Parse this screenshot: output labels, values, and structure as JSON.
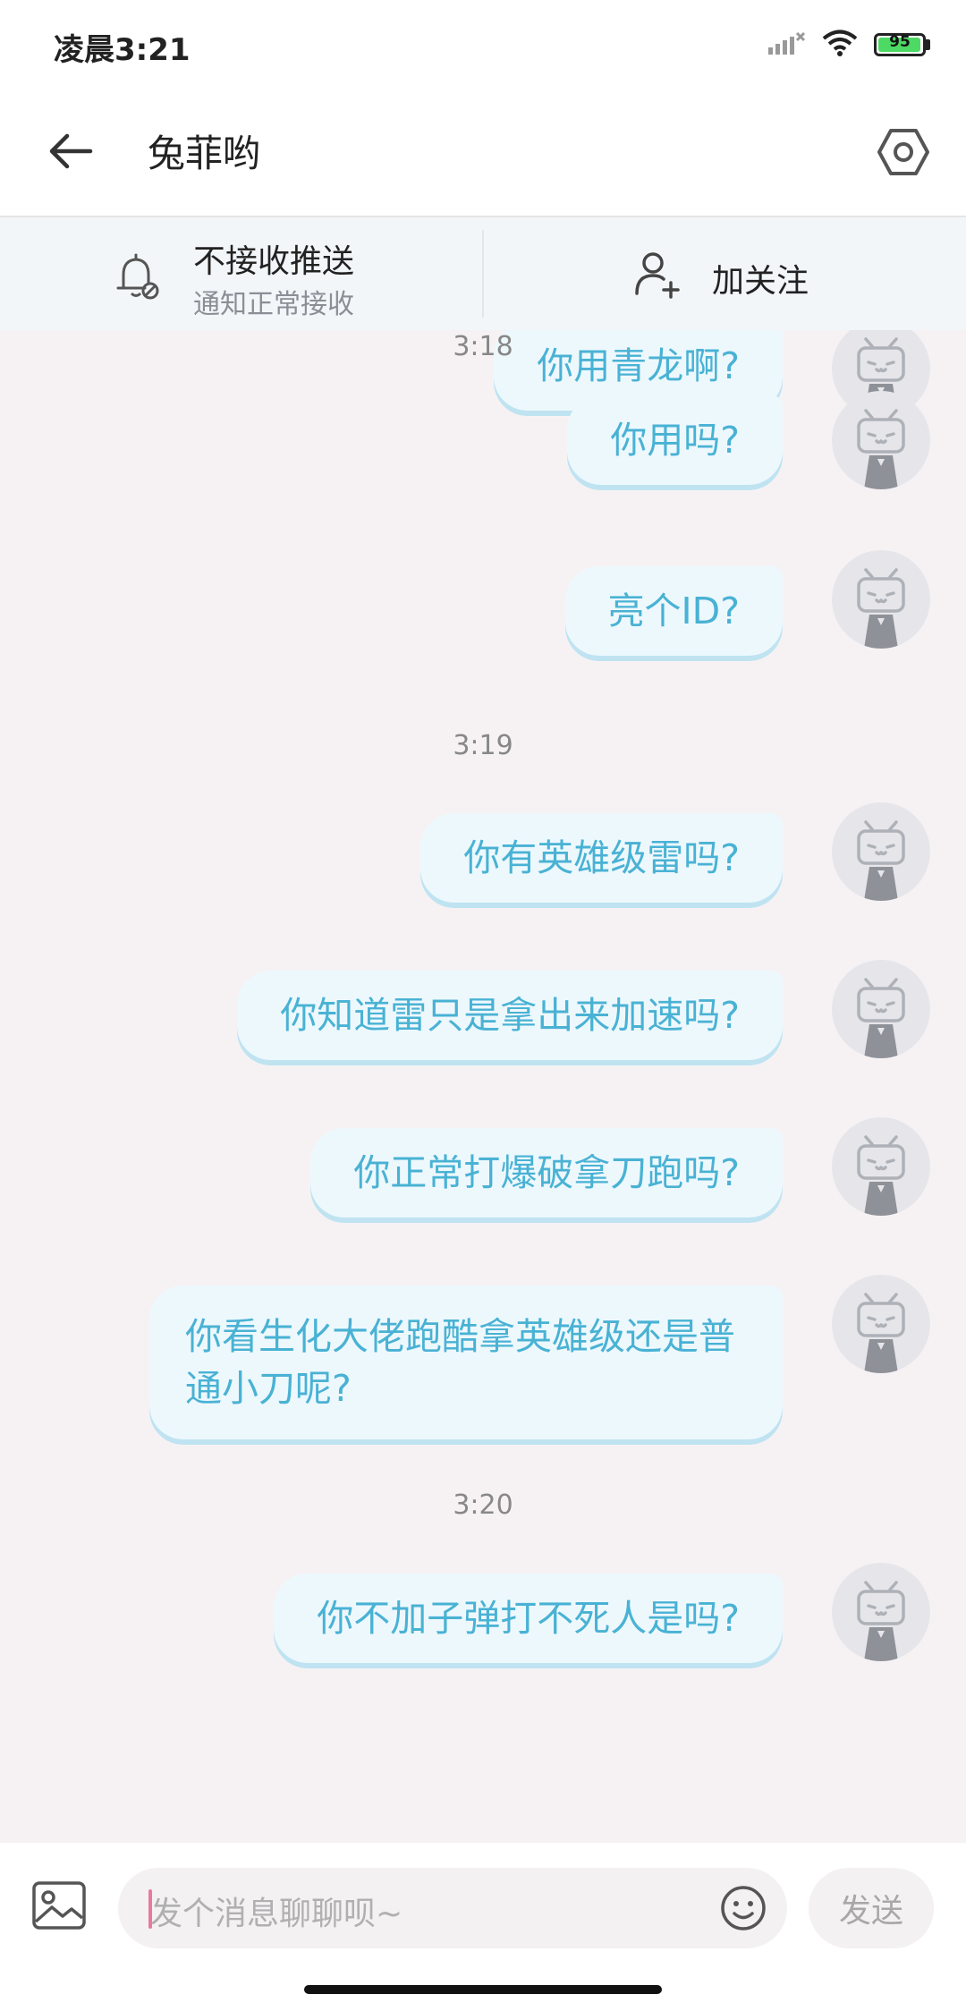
{
  "status_bar": {
    "time": "凌晨3:21",
    "battery": "95",
    "icons": [
      "signal-icon",
      "wifi-icon",
      "battery-icon"
    ]
  },
  "header": {
    "title": "兔菲哟",
    "back_icon": "arrow-left-icon",
    "settings_icon": "hexagon-settings-icon"
  },
  "subbar": {
    "push_title": "不接收推送",
    "push_subtitle": "通知正常接收",
    "follow_label": "加关注"
  },
  "messages": [
    {
      "type": "msg",
      "text": "你用青龙啊?"
    },
    {
      "type": "time",
      "text": "3:18"
    },
    {
      "type": "msg",
      "text": "你用吗?"
    },
    {
      "type": "msg",
      "text": "亮个ID?"
    },
    {
      "type": "time",
      "text": "3:19"
    },
    {
      "type": "msg",
      "text": "你有英雄级雷吗?"
    },
    {
      "type": "msg",
      "text": "你知道雷只是拿出来加速吗?"
    },
    {
      "type": "msg",
      "text": "你正常打爆破拿刀跑吗?"
    },
    {
      "type": "msg",
      "text": "你看生化大佬跑酷拿英雄级还是普通小刀呢?"
    },
    {
      "type": "time",
      "text": "3:20"
    },
    {
      "type": "msg",
      "text": "你不加子弹打不死人是吗?"
    }
  ],
  "input_bar": {
    "placeholder": "发个消息聊聊呗~",
    "send_label": "发送"
  },
  "colors": {
    "bubble_bg": "#edf8fd",
    "bubble_text": "#49b2d4",
    "caret": "#e87a9e"
  }
}
